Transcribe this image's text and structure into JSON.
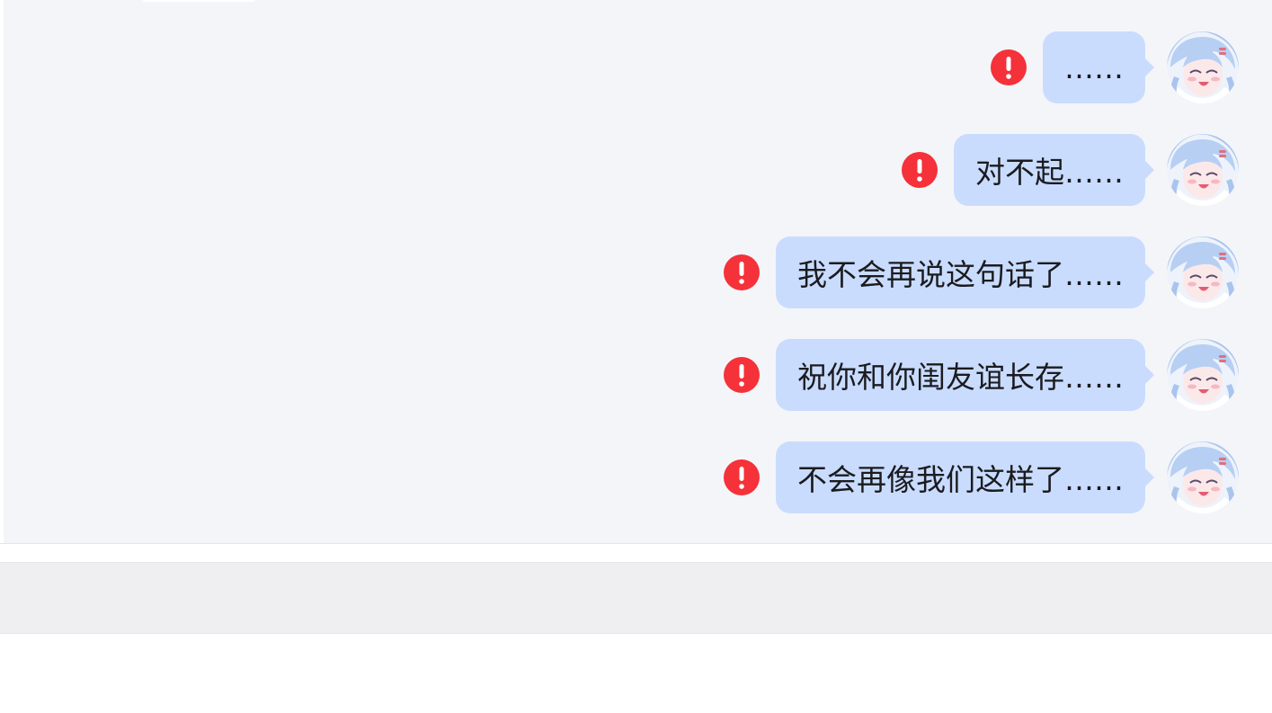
{
  "messages": [
    {
      "text": "……",
      "status": "failed",
      "status_icon": "exclamation-icon"
    },
    {
      "text": "对不起……",
      "status": "failed",
      "status_icon": "exclamation-icon"
    },
    {
      "text": "我不会再说这句话了……",
      "status": "failed",
      "status_icon": "exclamation-icon"
    },
    {
      "text": "祝你和你闺友谊长存……",
      "status": "failed",
      "status_icon": "exclamation-icon"
    },
    {
      "text": "不会再像我们这样了……",
      "status": "failed",
      "status_icon": "exclamation-icon"
    }
  ],
  "colors": {
    "chat_background": "#f4f5f9",
    "bubble": "#c9dcfe",
    "error": "#f5313a",
    "input_bar": "#efeff2",
    "text": "#1b1b1f"
  },
  "avatar": {
    "icon": "anime-girl-avatar-icon"
  }
}
